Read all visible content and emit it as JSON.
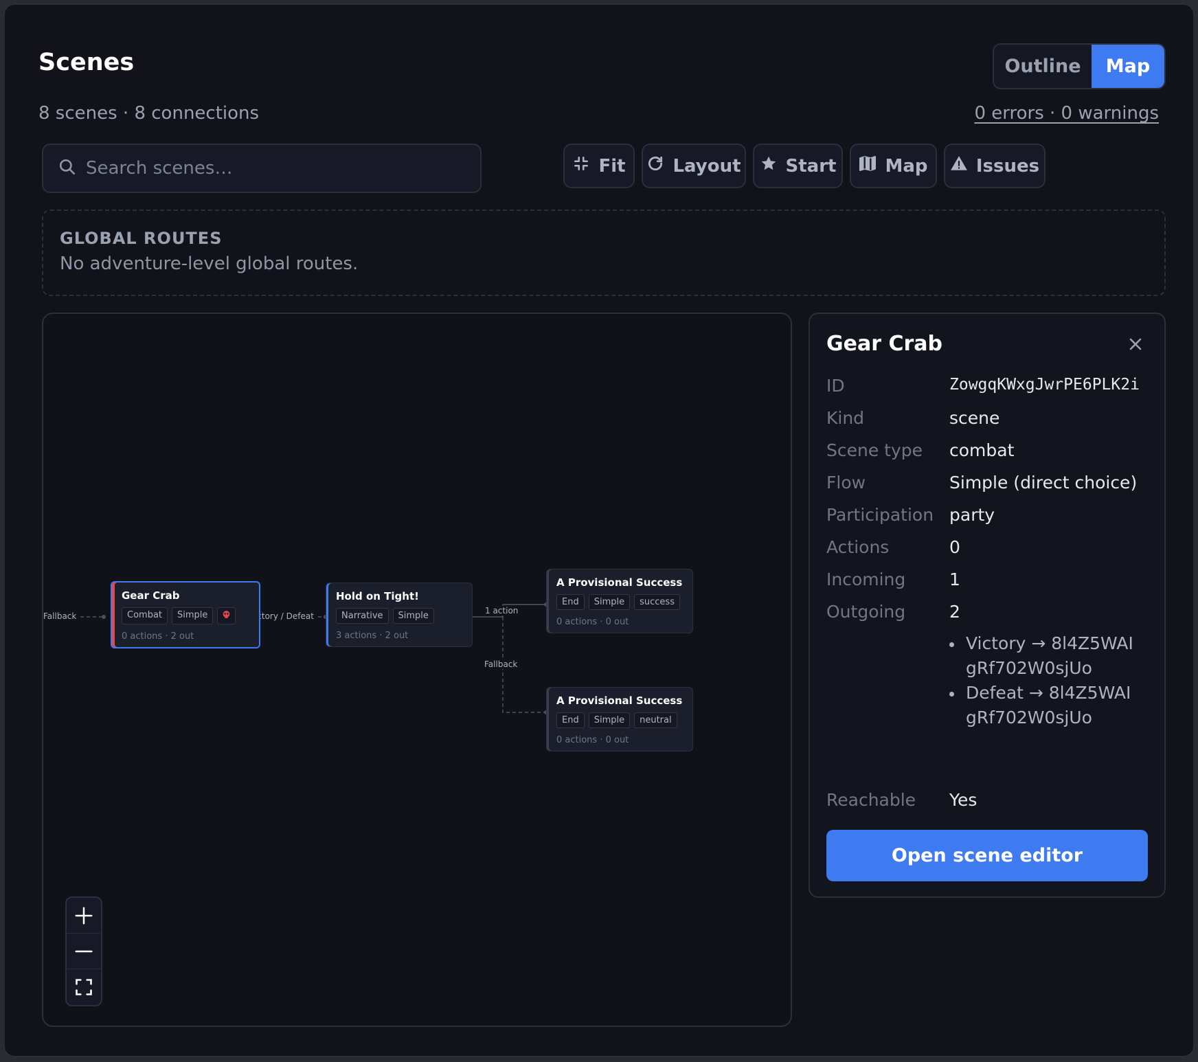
{
  "header": {
    "title": "Scenes",
    "subtitle": "8 scenes · 8 connections",
    "view_toggle": {
      "outline": "Outline",
      "map": "Map",
      "active": "Map"
    },
    "issues_summary": "0 errors · 0 warnings"
  },
  "search": {
    "placeholder": "Search scenes…",
    "value": ""
  },
  "toolbar": {
    "fit": "Fit",
    "layout": "Layout",
    "start": "Start",
    "map": "Map",
    "issues": "Issues"
  },
  "global_routes": {
    "heading": "GLOBAL ROUTES",
    "empty_text": "No adventure-level global routes."
  },
  "graph": {
    "nodes": [
      {
        "title": "Gear Crab",
        "tags": [
          "Combat",
          "Simple"
        ],
        "meta": "0 actions · 2 out",
        "selected": true,
        "has_error_icon": true
      },
      {
        "title": "Hold on Tight!",
        "tags": [
          "Narrative",
          "Simple"
        ],
        "meta": "3 actions · 2 out"
      },
      {
        "title": "A Provisional Success",
        "tags": [
          "End",
          "Simple",
          "success"
        ],
        "meta": "0 actions · 0 out"
      },
      {
        "title": "A Provisional Success",
        "tags": [
          "End",
          "Simple",
          "neutral"
        ],
        "meta": "0 actions · 0 out"
      }
    ],
    "edge_labels": {
      "fallback_in": "Fallback",
      "victory_defeat": "Victory / Defeat",
      "one_action": "1 action",
      "fallback": "Fallback"
    },
    "colors": {
      "selected_border": "#3e7bf0",
      "combat_accent": "#e5484d",
      "narrative_accent": "#3e7bf0",
      "error": "#e5484d"
    }
  },
  "zoom_controls": [
    "zoom-in",
    "zoom-out",
    "fullscreen"
  ],
  "detail_panel": {
    "title": "Gear Crab",
    "fields": {
      "id": {
        "label": "ID",
        "value": "ZowgqKWxgJwrPE6PLK2i"
      },
      "kind": {
        "label": "Kind",
        "value": "scene"
      },
      "scene_type": {
        "label": "Scene type",
        "value": "combat"
      },
      "flow": {
        "label": "Flow",
        "value": "Simple (direct choice)"
      },
      "participation": {
        "label": "Participation",
        "value": "party"
      },
      "actions": {
        "label": "Actions",
        "value": "0"
      },
      "incoming": {
        "label": "Incoming",
        "value": "1"
      },
      "outgoing": {
        "label": "Outgoing",
        "value": "2"
      },
      "reachable": {
        "label": "Reachable",
        "value": "Yes"
      }
    },
    "outgoing_list": [
      "Victory → 8l4Z5WAIgRf702W0sjUo",
      "Defeat → 8l4Z5WAIgRf702W0sjUo"
    ],
    "open_button": "Open scene editor"
  },
  "accent_color": "#3e7bf0"
}
